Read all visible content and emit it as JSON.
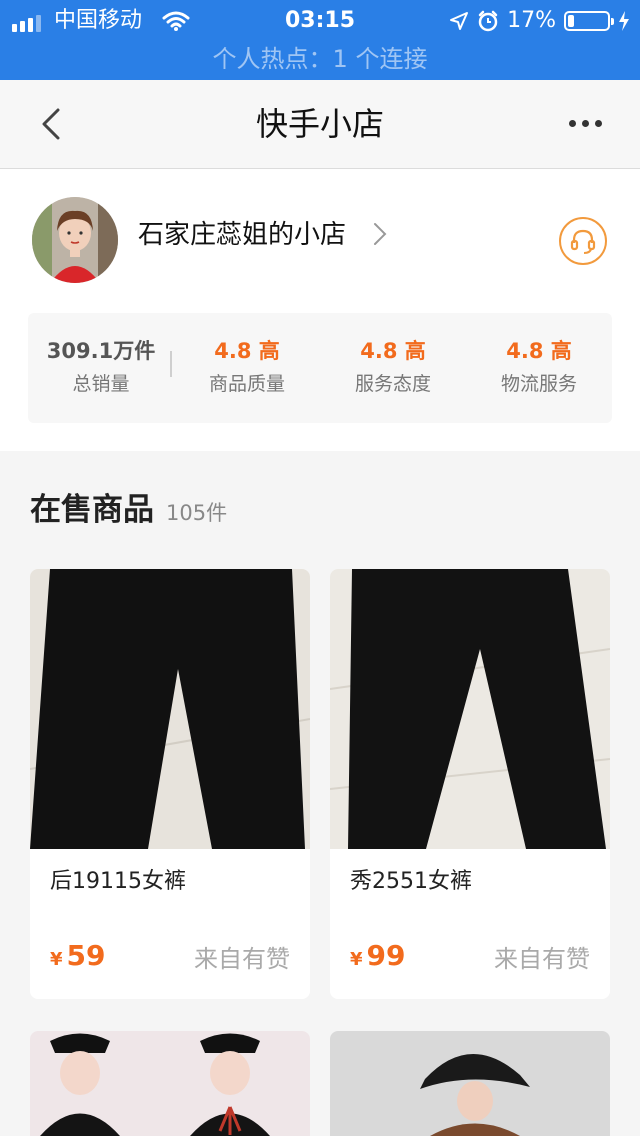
{
  "status_bar": {
    "carrier": "中国移动",
    "time": "03:15",
    "battery": "17%",
    "battery_level": 0.17,
    "hotspot": "个人热点：1 个连接"
  },
  "nav": {
    "title": "快手小店"
  },
  "shop": {
    "name": "石家庄蕊姐的小店",
    "stats": [
      {
        "value": "309.1万件",
        "label": "总销量"
      },
      {
        "value": "4.8 高",
        "label": "商品质量"
      },
      {
        "value": "4.8 高",
        "label": "服务态度"
      },
      {
        "value": "4.8 高",
        "label": "物流服务"
      }
    ]
  },
  "section": {
    "title": "在售商品",
    "count": "105件"
  },
  "products": [
    {
      "title": "后19115女裤",
      "currency": "¥",
      "price": "59",
      "source": "来自有赞"
    },
    {
      "title": "秀2551女裤",
      "currency": "¥",
      "price": "99",
      "source": "来自有赞"
    }
  ],
  "colors": {
    "status_bar": "#2a7fe6",
    "accent": "#f26b1d",
    "service_icon": "#f29a3d"
  }
}
